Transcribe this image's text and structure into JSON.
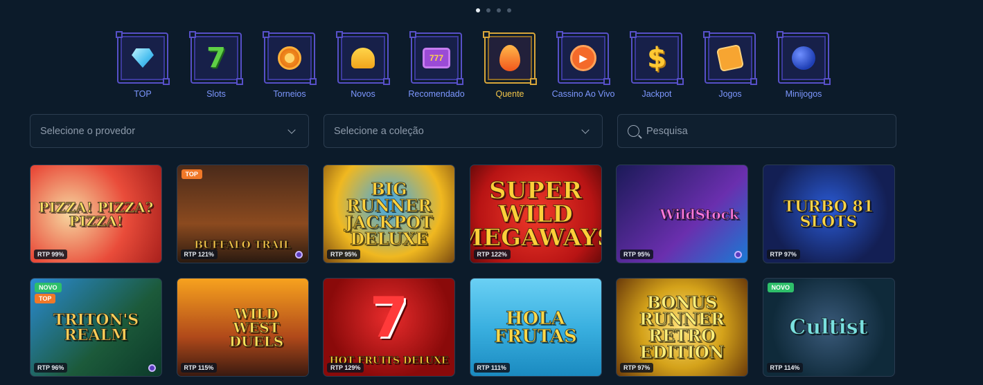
{
  "carousel": {
    "total": 4,
    "active": 0
  },
  "categories": [
    {
      "label": "TOP",
      "icon": "diamond-icon",
      "active": false
    },
    {
      "label": "Slots",
      "icon": "seven-icon",
      "active": false
    },
    {
      "label": "Torneios",
      "icon": "medal-icon",
      "active": false
    },
    {
      "label": "Novos",
      "icon": "bell-icon",
      "active": false
    },
    {
      "label": "Recomendado",
      "icon": "slot-machine-icon",
      "active": false
    },
    {
      "label": "Quente",
      "icon": "flame-icon",
      "active": true
    },
    {
      "label": "Cassino Ao Vivo",
      "icon": "play-icon",
      "active": false
    },
    {
      "label": "Jackpot",
      "icon": "dollar-icon",
      "active": false
    },
    {
      "label": "Jogos",
      "icon": "dice-icon",
      "active": false
    },
    {
      "label": "Minijogos",
      "icon": "bomb-icon",
      "active": false
    }
  ],
  "filters": {
    "provider": "Selecione o provedor",
    "collection": "Selecione a coleção",
    "search_placeholder": "Pesquisa"
  },
  "games": [
    {
      "title": "PIZZA! PIZZA? PIZZA!",
      "rtp": "RTP 99%",
      "badges": [],
      "award": false
    },
    {
      "title": "BUFFALO TRAIL",
      "rtp": "RTP 121%",
      "badges": [
        "TOP"
      ],
      "award": true
    },
    {
      "title": "BIG RUNNER Jackpot deluxe",
      "rtp": "RTP 95%",
      "badges": [],
      "award": false
    },
    {
      "title": "SUPER WILD MEGAWAYS",
      "rtp": "RTP 122%",
      "badges": [],
      "award": false
    },
    {
      "title": "WildStock",
      "rtp": "RTP 95%",
      "badges": [],
      "award": true
    },
    {
      "title": "TURBO 81 SLOTS",
      "rtp": "RTP 97%",
      "badges": [],
      "award": false
    },
    {
      "title": "TRITON'S REALM",
      "rtp": "RTP 96%",
      "badges": [
        "NOVO",
        "TOP"
      ],
      "award": true
    },
    {
      "title": "WILD WEST DUELS",
      "rtp": "RTP 115%",
      "badges": [],
      "award": false
    },
    {
      "title": "HOT FRUITS DELUXE",
      "rtp": "RTP 129%",
      "badges": [],
      "award": false
    },
    {
      "title": "HOLA FRUTAS",
      "rtp": "RTP 111%",
      "badges": [],
      "award": false
    },
    {
      "title": "BONUS RUNNER Retro Edition",
      "rtp": "RTP 97%",
      "badges": [],
      "award": false
    },
    {
      "title": "Cultist",
      "rtp": "RTP 114%",
      "badges": [
        "NOVO"
      ],
      "award": false
    }
  ]
}
